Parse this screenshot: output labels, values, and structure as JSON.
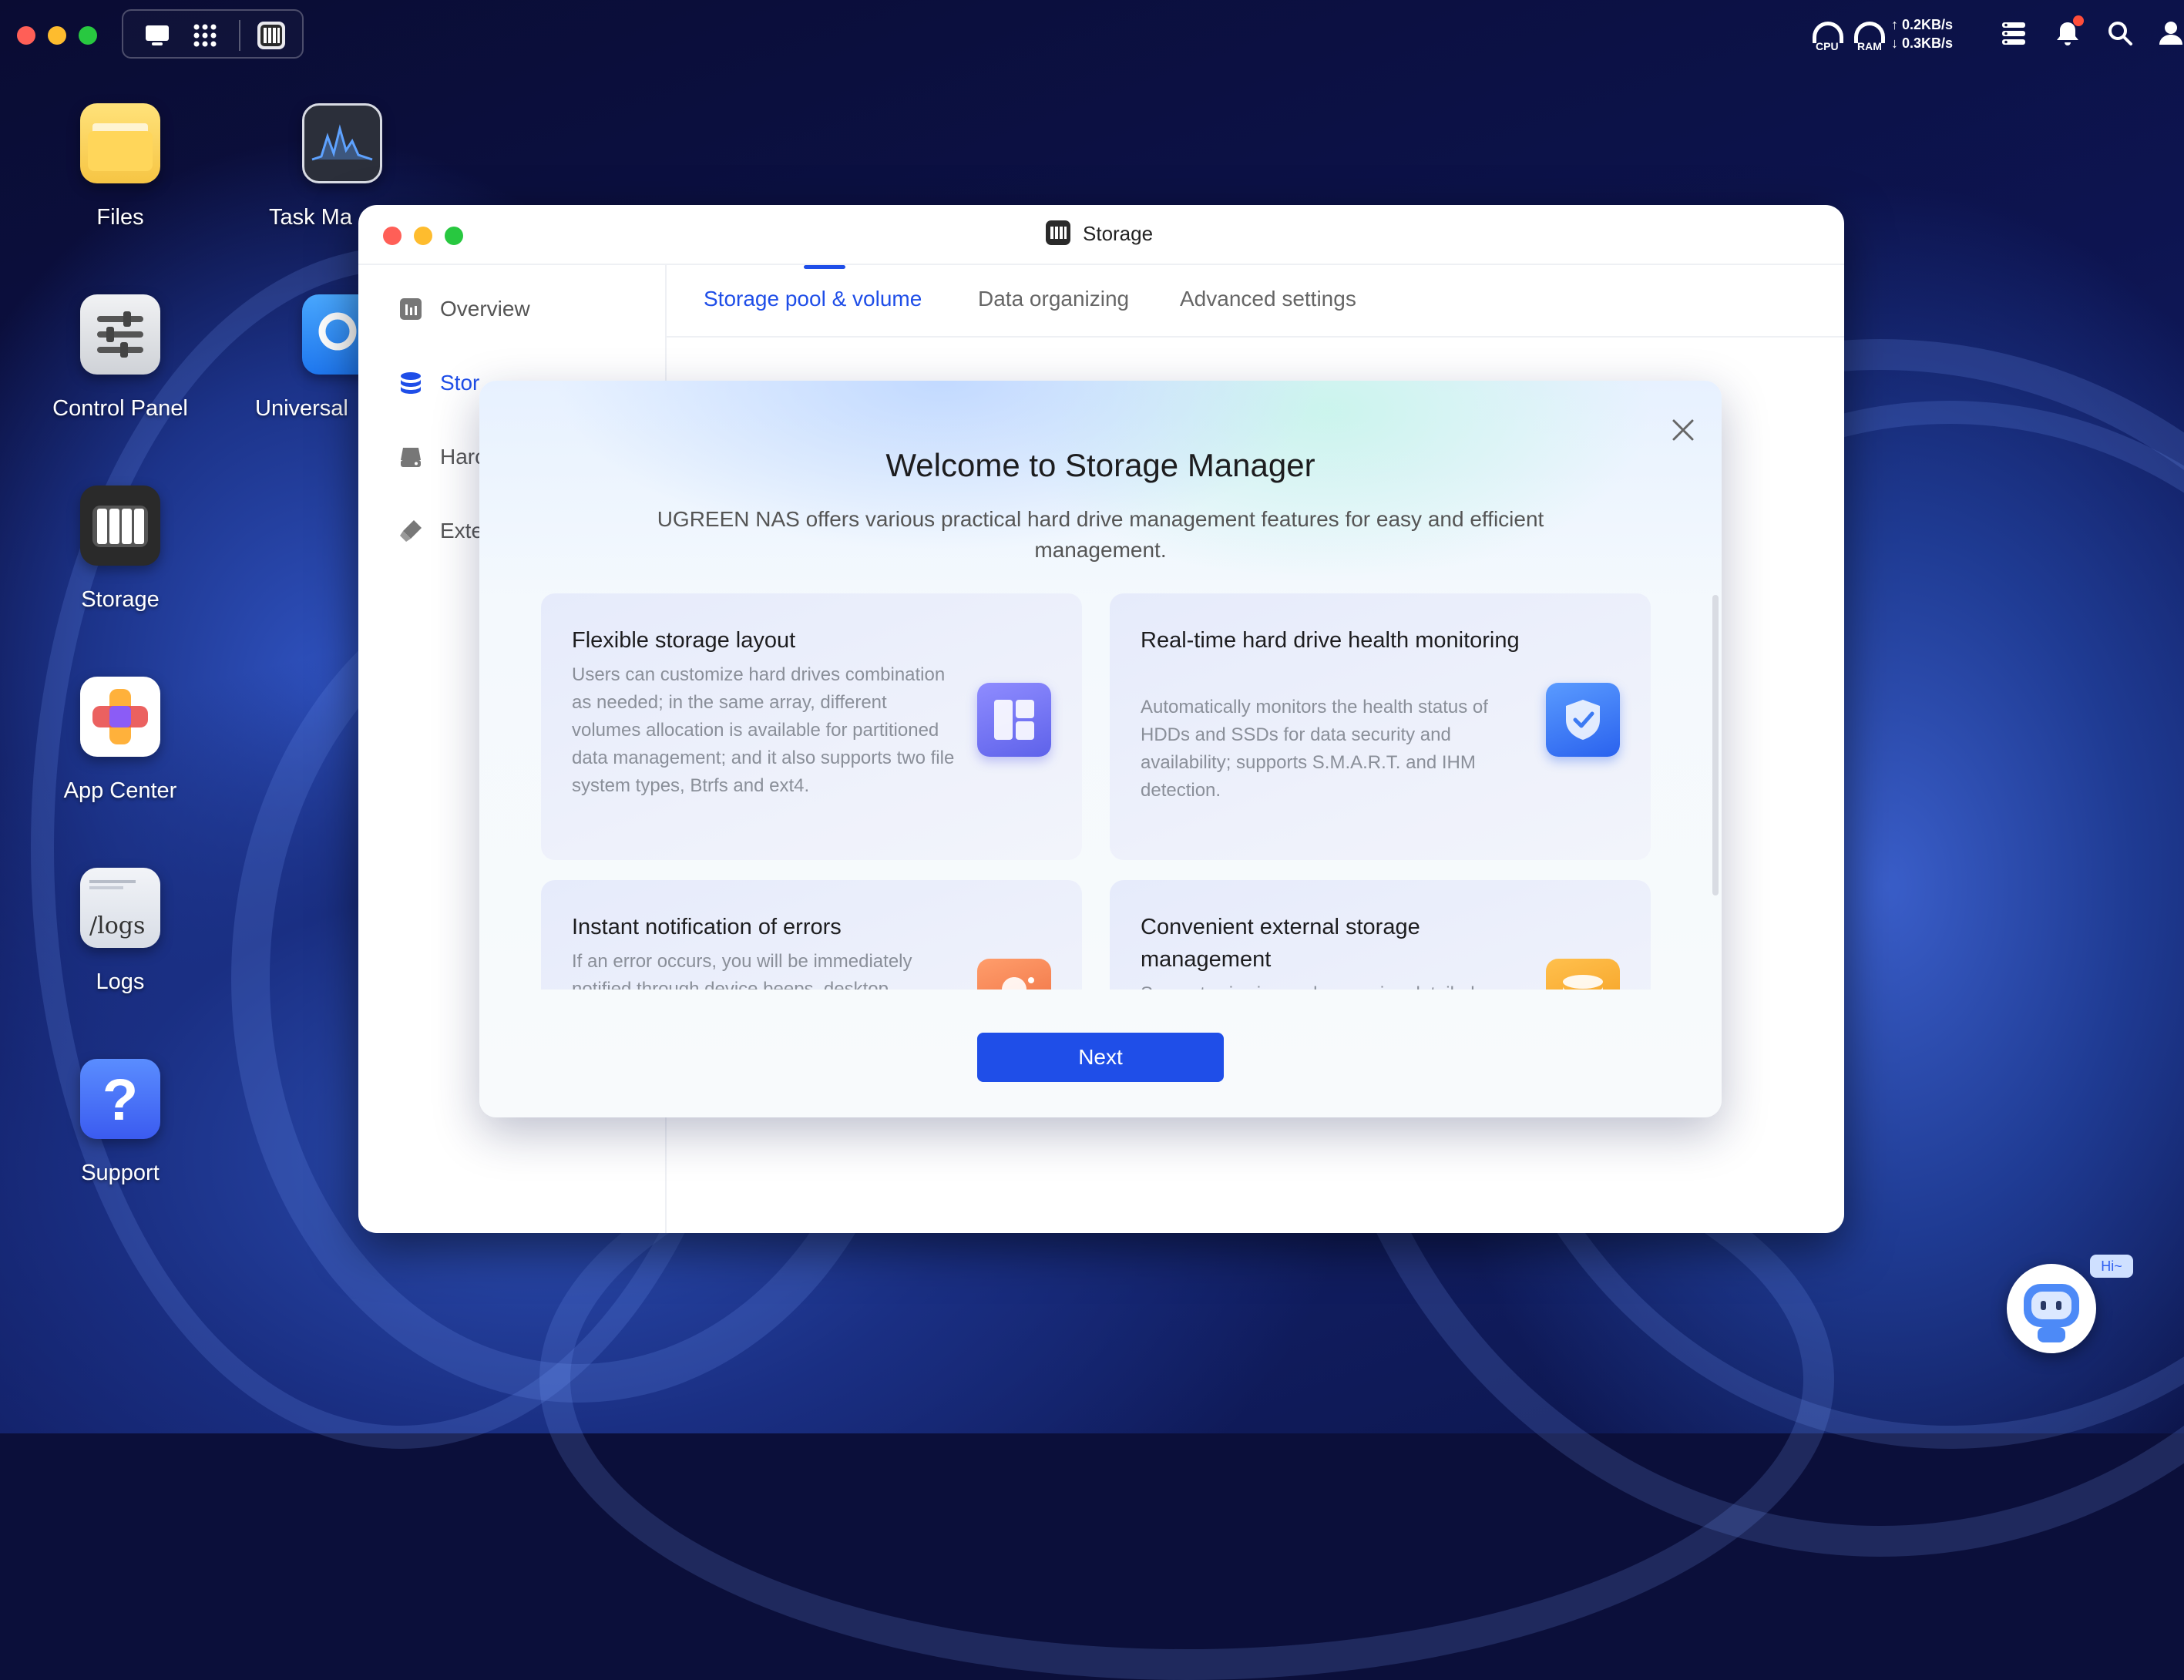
{
  "desktop": {
    "apps": [
      {
        "label": "Files",
        "icon": "folder-icon"
      },
      {
        "label": "Task Ma",
        "icon": "task-manager-icon"
      },
      {
        "label": "Control Panel",
        "icon": "control-panel-icon"
      },
      {
        "label": "Universal",
        "icon": "universal-search-icon"
      },
      {
        "label": "Storage",
        "icon": "storage-icon"
      },
      {
        "label": "App Center",
        "icon": "app-center-icon"
      },
      {
        "label": "Logs",
        "icon": "logs-icon",
        "glyph": "/logs"
      },
      {
        "label": "Support",
        "icon": "support-icon",
        "glyph": "?"
      }
    ]
  },
  "statusbar": {
    "cpu_label": "CPU",
    "ram_label": "RAM",
    "upload": "↑ 0.2KB/s",
    "download": "↓ 0.3KB/s"
  },
  "window": {
    "title": "Storage",
    "sidebar": [
      {
        "label": "Overview",
        "icon": "overview-icon"
      },
      {
        "label": "Stor",
        "icon": "database-icon"
      },
      {
        "label": "Harc",
        "icon": "hard-drive-icon"
      },
      {
        "label": "Exte",
        "icon": "external-storage-icon"
      }
    ],
    "tabs": [
      {
        "label": "Storage pool & volume"
      },
      {
        "label": "Data organizing"
      },
      {
        "label": "Advanced settings"
      }
    ]
  },
  "modal": {
    "title": "Welcome to Storage Manager",
    "subtitle": "UGREEN NAS offers various practical hard drive management features for easy and efficient management.",
    "cards": [
      {
        "title": "Flexible storage layout",
        "desc": "Users can customize hard drives combination as needed; in the same array, different volumes allocation is available for partitioned data management; and it also supports two file system types, Btrfs and ext4.",
        "icon": "layout-icon"
      },
      {
        "title": "Real-time hard drive health monitoring",
        "desc": "Automatically monitors the health status of HDDs and SSDs for data security and availability; supports S.M.A.R.T. and IHM detection.",
        "icon": "shield-check-icon"
      },
      {
        "title": "Instant notification of errors",
        "desc": "If an error occurs, you will be immediately notified through device beeps, desktop",
        "icon": "bell-icon"
      },
      {
        "title": "Convenient external storage management",
        "desc": "Supports viewing and accessing detailed",
        "icon": "disk-stack-icon"
      }
    ],
    "next_label": "Next"
  },
  "assistant": {
    "bubble": "Hi~"
  },
  "colors": {
    "accent": "#1f4ee8",
    "card_layout": "#6c6ff0",
    "card_shield": "#3c7af3",
    "card_bell": "#ef7d4e",
    "card_disk": "#f5a52a"
  }
}
